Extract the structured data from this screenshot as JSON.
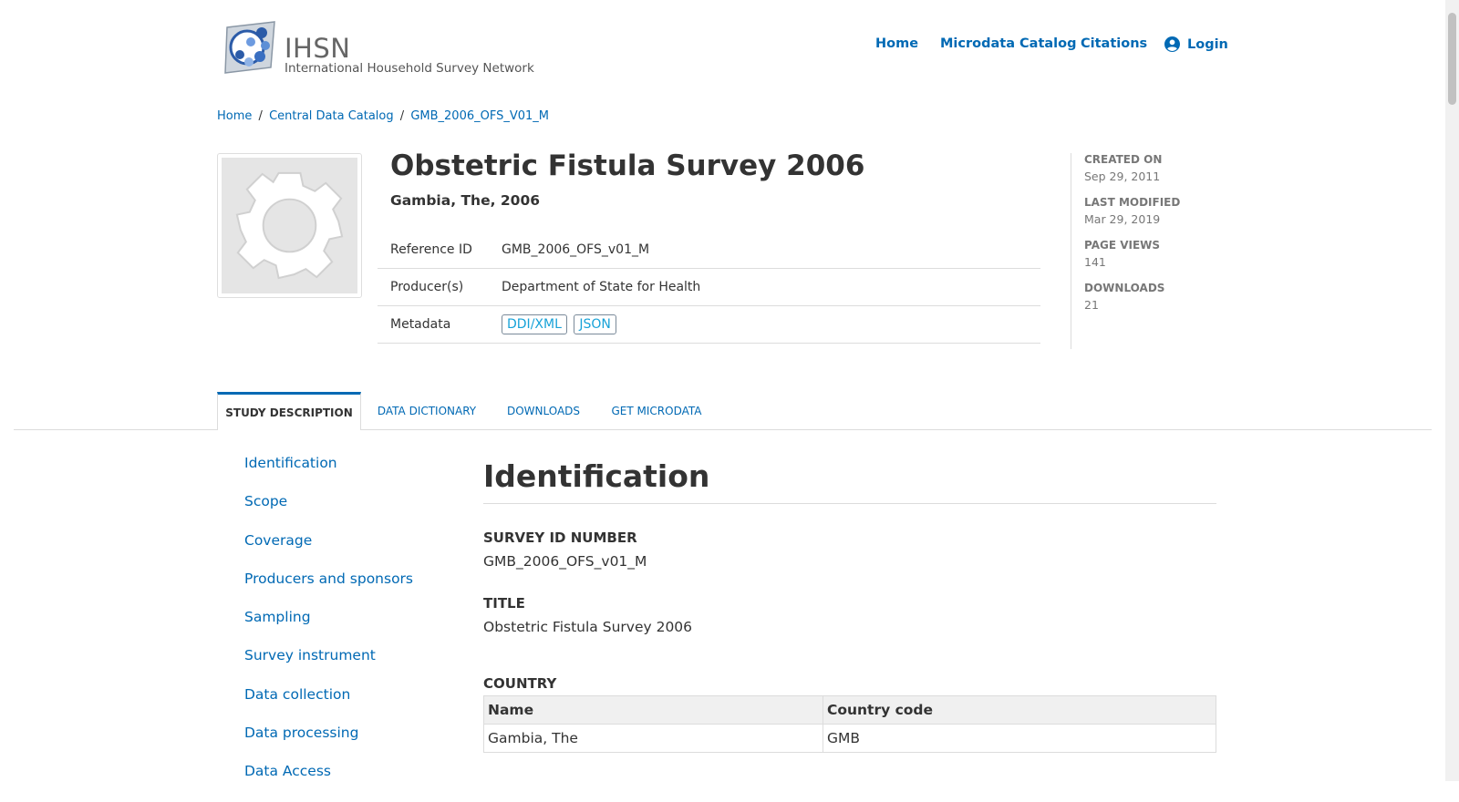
{
  "header": {
    "logo_title": "IHSN",
    "logo_subtitle": "International Household Survey Network",
    "nav": {
      "home": "Home",
      "catalog": "Microdata Catalog",
      "citations": "Citations",
      "login": "Login"
    }
  },
  "breadcrumb": {
    "items": [
      "Home",
      "Central Data Catalog",
      "GMB_2006_OFS_V01_M"
    ],
    "separator": "/"
  },
  "study": {
    "title": "Obstetric Fistula Survey 2006",
    "subtitle": "Gambia, The, 2006",
    "meta": [
      {
        "label": "Reference ID",
        "value": "GMB_2006_OFS_v01_M"
      },
      {
        "label": "Producer(s)",
        "value": "Department of State for Health"
      },
      {
        "label": "Metadata",
        "buttons": [
          "DDI/XML",
          "JSON"
        ]
      }
    ],
    "stats": [
      {
        "label": "CREATED ON",
        "value": "Sep 29, 2011"
      },
      {
        "label": "LAST MODIFIED",
        "value": "Mar 29, 2019"
      },
      {
        "label": "PAGE VIEWS",
        "value": "141"
      },
      {
        "label": "DOWNLOADS",
        "value": "21"
      }
    ]
  },
  "tabs": [
    "STUDY DESCRIPTION",
    "DATA DICTIONARY",
    "DOWNLOADS",
    "GET MICRODATA"
  ],
  "sidenav": [
    "Identification",
    "Scope",
    "Coverage",
    "Producers and sponsors",
    "Sampling",
    "Survey instrument",
    "Data collection",
    "Data processing",
    "Data Access"
  ],
  "content": {
    "heading": "Identification",
    "survey_id_label": "SURVEY ID NUMBER",
    "survey_id_value": "GMB_2006_OFS_v01_M",
    "title_label": "TITLE",
    "title_value": "Obstetric Fistula Survey 2006",
    "country_label": "COUNTRY",
    "country_table": {
      "headers": [
        "Name",
        "Country code"
      ],
      "rows": [
        [
          "Gambia, The",
          "GMB"
        ]
      ]
    }
  },
  "colors": {
    "link": "#0069b4",
    "accent_button": "#17a2d8",
    "text": "#333333",
    "muted": "#777777"
  }
}
